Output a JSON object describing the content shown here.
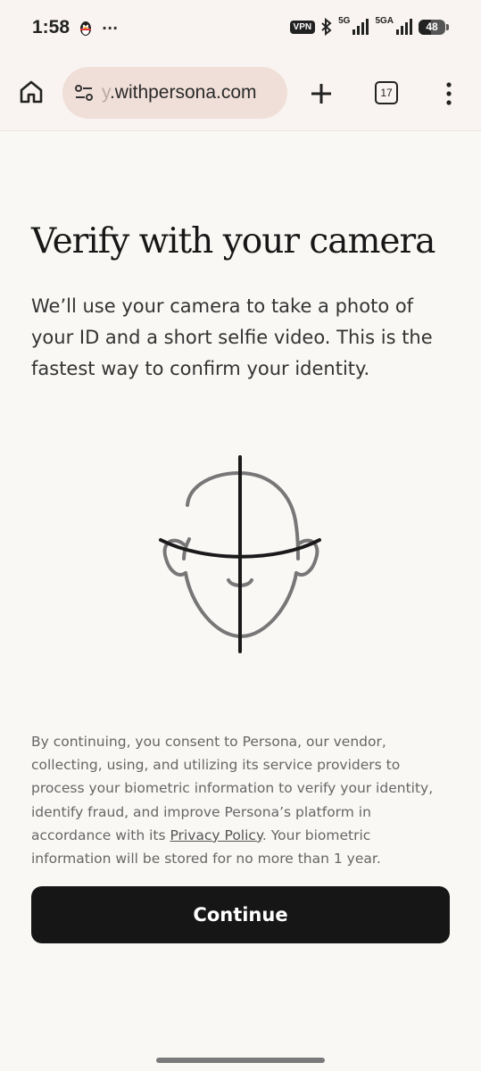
{
  "status_bar": {
    "time": "1:58",
    "more": "···",
    "vpn": "VPN",
    "net1": "5G",
    "net2": "5GA",
    "battery": "48"
  },
  "browser": {
    "url_faded": "y",
    "url_main": ".withpersona.com",
    "tab_count": "17"
  },
  "page": {
    "title": "Verify with your camera",
    "description": "We’ll use your camera to take a photo of your ID and a short selfie video. This is the fastest way to confirm your identity.",
    "consent_before": "By continuing, you consent to Persona, our vendor, collecting, using, and utilizing its service providers to process your biometric information to verify your identity, identify fraud, and improve Persona’s platform in accordance with its ",
    "privacy_link": "Privacy Policy",
    "consent_after": ". Your biometric information will be stored for no more than 1 year.",
    "continue_label": "Continue"
  }
}
